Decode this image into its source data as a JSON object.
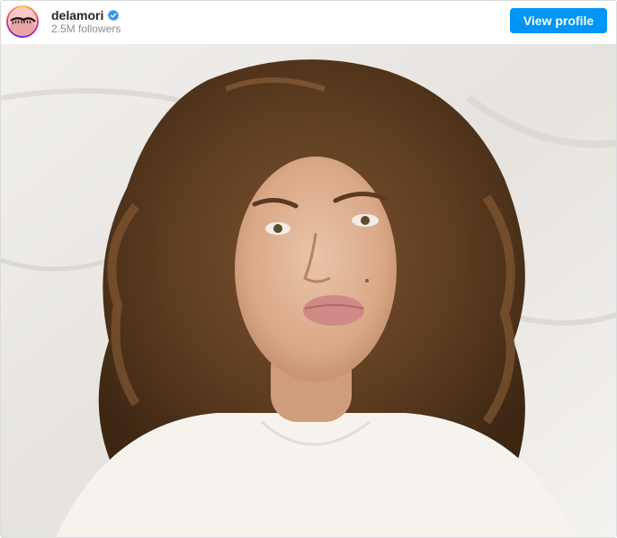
{
  "profile": {
    "username": "delamori",
    "verified": true,
    "followers": "2.5M followers",
    "avatar_icon": "profile-avatar"
  },
  "actions": {
    "view_profile_label": "View profile"
  },
  "colors": {
    "button_bg": "#0095f6",
    "verified_badge": "#3897f0",
    "secondary_text": "#8e8e8e",
    "primary_text": "#262626"
  },
  "post": {
    "image_icon": "selfie-photo"
  }
}
